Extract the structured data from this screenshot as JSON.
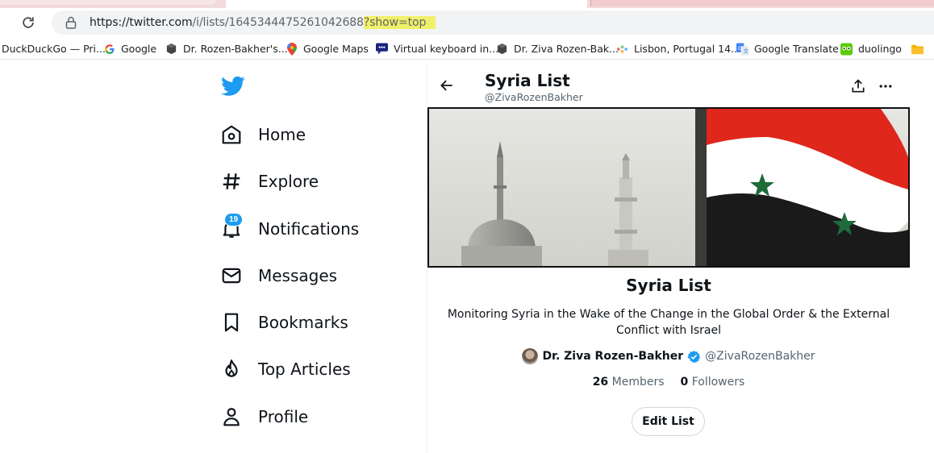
{
  "browser": {
    "url_host": "https://twitter.com",
    "url_path": "/i/lists/1645344475261042688",
    "url_query": "?show=top",
    "bookmarks": [
      {
        "label": "DuckDuckGo — Pri...",
        "icon": "none"
      },
      {
        "label": "Google",
        "icon": "google-icon"
      },
      {
        "label": "Dr. Rozen-Bakher's...",
        "icon": "cube-icon"
      },
      {
        "label": "Google Maps",
        "icon": "maps-pin-icon"
      },
      {
        "label": "Virtual keyboard in...",
        "icon": "chat-icon"
      },
      {
        "label": "Dr. Ziva Rozen-Bak...",
        "icon": "cube-icon"
      },
      {
        "label": "Lisbon, Portugal 14...",
        "icon": "dots-icon"
      },
      {
        "label": "Google Translate",
        "icon": "translate-icon"
      },
      {
        "label": "duolingo",
        "icon": "duolingo-icon"
      },
      {
        "label": "",
        "icon": "folder-icon"
      }
    ]
  },
  "sidebar": {
    "items": [
      {
        "label": "Home",
        "icon": "home-icon"
      },
      {
        "label": "Explore",
        "icon": "hashtag-icon"
      },
      {
        "label": "Notifications",
        "icon": "bell-icon",
        "badge": "19"
      },
      {
        "label": "Messages",
        "icon": "envelope-icon"
      },
      {
        "label": "Bookmarks",
        "icon": "bookmark-icon"
      },
      {
        "label": "Top Articles",
        "icon": "flame-icon"
      },
      {
        "label": "Profile",
        "icon": "person-icon"
      }
    ]
  },
  "header": {
    "title": "Syria List",
    "handle": "@ZivaRozenBakher"
  },
  "list": {
    "name": "Syria List",
    "description": "Monitoring Syria in the Wake of the Change in the Global Order & the External Conflict with Israel",
    "owner_name": "Dr. Ziva Rozen-Bakher",
    "owner_handle": "@ZivaRozenBakher",
    "members_count": "26",
    "members_label": "Members",
    "followers_count": "0",
    "followers_label": "Followers",
    "edit_label": "Edit List"
  },
  "colors": {
    "twitter_blue": "#1d9bf0",
    "text_primary": "#0f1419",
    "text_secondary": "#536471",
    "flag_red": "#e0271b",
    "flag_green": "#1f6b3c"
  }
}
